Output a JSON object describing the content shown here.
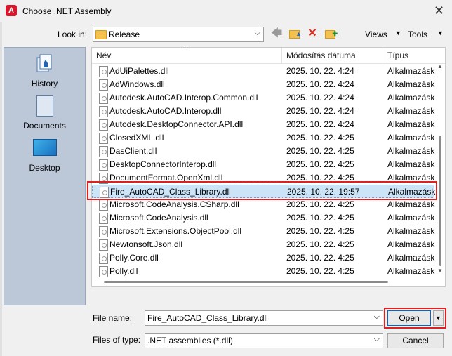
{
  "window": {
    "title": "Choose .NET Assembly",
    "close_glyph": "✕",
    "app_icon_letter": "A"
  },
  "toolbar": {
    "look_in_label": "Look in:",
    "look_in_value": "Release",
    "views_label": "Views",
    "tools_label": "Tools",
    "icons": [
      "back-icon",
      "up-folder-icon",
      "delete-icon",
      "new-folder-icon"
    ]
  },
  "places": [
    {
      "label": "History",
      "icon": "history-icon"
    },
    {
      "label": "Documents",
      "icon": "documents-icon"
    },
    {
      "label": "Desktop",
      "icon": "desktop-icon"
    }
  ],
  "columns": {
    "name": "Név",
    "date": "Módosítás dátuma",
    "type": "Típus"
  },
  "files": [
    {
      "name": "AdUiPalettes.dll",
      "date": "2025. 10. 22. 4:24",
      "type": "Alkalmazásk"
    },
    {
      "name": "AdWindows.dll",
      "date": "2025. 10. 22. 4:24",
      "type": "Alkalmazásk"
    },
    {
      "name": "Autodesk.AutoCAD.Interop.Common.dll",
      "date": "2025. 10. 22. 4:24",
      "type": "Alkalmazásk"
    },
    {
      "name": "Autodesk.AutoCAD.Interop.dll",
      "date": "2025. 10. 22. 4:24",
      "type": "Alkalmazásk"
    },
    {
      "name": "Autodesk.DesktopConnector.API.dll",
      "date": "2025. 10. 22. 4:24",
      "type": "Alkalmazásk"
    },
    {
      "name": "ClosedXML.dll",
      "date": "2025. 10. 22. 4:25",
      "type": "Alkalmazásk"
    },
    {
      "name": "DasClient.dll",
      "date": "2025. 10. 22. 4:25",
      "type": "Alkalmazásk"
    },
    {
      "name": "DesktopConnectorInterop.dll",
      "date": "2025. 10. 22. 4:25",
      "type": "Alkalmazásk"
    },
    {
      "name": "DocumentFormat.OpenXml.dll",
      "date": "2025. 10. 22. 4:25",
      "type": "Alkalmazásk"
    },
    {
      "name": "Fire_AutoCAD_Class_Library.dll",
      "date": "2025. 10. 22. 19:57",
      "type": "Alkalmazásk",
      "selected": true
    },
    {
      "name": "Microsoft.CodeAnalysis.CSharp.dll",
      "date": "2025. 10. 22. 4:25",
      "type": "Alkalmazásk"
    },
    {
      "name": "Microsoft.CodeAnalysis.dll",
      "date": "2025. 10. 22. 4:25",
      "type": "Alkalmazásk"
    },
    {
      "name": "Microsoft.Extensions.ObjectPool.dll",
      "date": "2025. 10. 22. 4:25",
      "type": "Alkalmazásk"
    },
    {
      "name": "Newtonsoft.Json.dll",
      "date": "2025. 10. 22. 4:25",
      "type": "Alkalmazásk"
    },
    {
      "name": "Polly.Core.dll",
      "date": "2025. 10. 22. 4:25",
      "type": "Alkalmazásk"
    },
    {
      "name": "Polly.dll",
      "date": "2025. 10. 22. 4:25",
      "type": "Alkalmazásk"
    }
  ],
  "bottom": {
    "file_name_label": "File name:",
    "file_name_value": "Fire_AutoCAD_Class_Library.dll",
    "files_of_type_label": "Files of type:",
    "files_of_type_value": ".NET assemblies (*.dll)",
    "open_label": "Open",
    "cancel_label": "Cancel"
  },
  "colors": {
    "highlight": "#e02020",
    "selection": "#cce4f7",
    "places_panel": "#bcc8d8",
    "app_icon": "#d6162c"
  }
}
